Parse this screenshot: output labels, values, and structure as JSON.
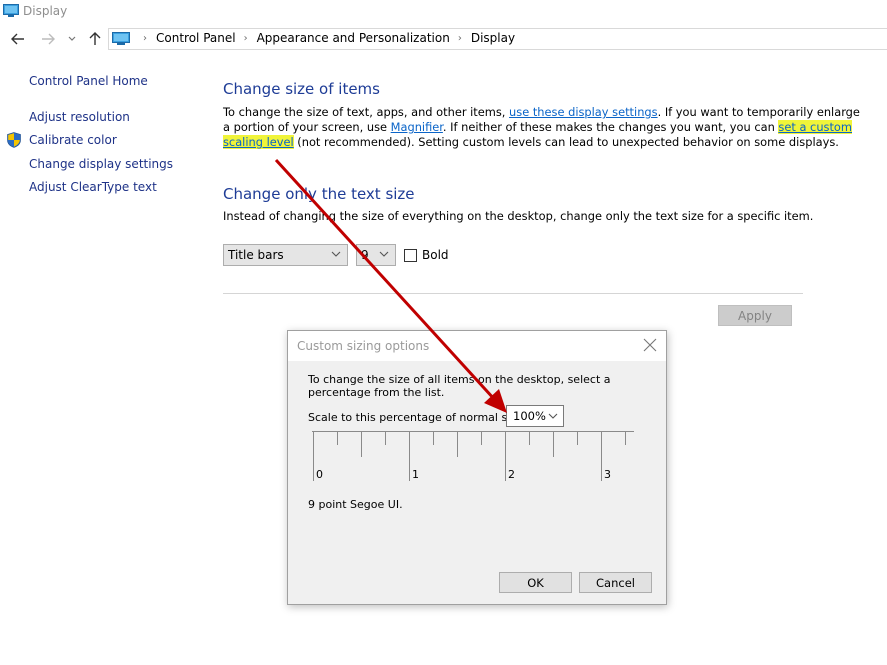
{
  "window": {
    "title": "Display",
    "icon": "monitor-icon"
  },
  "nav": {
    "back": "back-arrow-icon",
    "forward": "forward-arrow-icon",
    "recent": "chevron-down-icon",
    "up": "up-arrow-icon",
    "breadcrumbs": [
      "Control Panel",
      "Appearance and Personalization",
      "Display"
    ]
  },
  "sidebar": {
    "home": "Control Panel Home",
    "items": [
      {
        "label": "Adjust resolution",
        "icon": null
      },
      {
        "label": "Calibrate color",
        "icon": "uac-shield-icon"
      },
      {
        "label": "Change display settings",
        "icon": null
      },
      {
        "label": "Adjust ClearType text",
        "icon": null
      }
    ]
  },
  "main": {
    "section1": {
      "heading": "Change size of items",
      "line1_pre": "To change the size of text, apps, and other items, ",
      "line1_link": "use these display settings",
      "line1_post": ".  If you want to temporarily enlarge",
      "line2_pre": "a portion of your screen, use ",
      "line2_link": "Magnifier",
      "line2_post": ".  If neither of these makes the changes you want, you can ",
      "line2_link2": "set a custom",
      "line3_link": "scaling level",
      "line3_post": " (not recommended).  Setting custom levels can lead to unexpected behavior on some displays."
    },
    "section2": {
      "heading": "Change only the text size",
      "description": "Instead of changing the size of everything on the desktop, change only the text size for a specific item.",
      "item_select": "Title bars",
      "size_select": "9",
      "bold_label": "Bold",
      "bold_checked": false
    },
    "apply_label": "Apply"
  },
  "dialog": {
    "title": "Custom sizing options",
    "instruction_line1": "To change the size of all items on the desktop, select a",
    "instruction_line2": "percentage from the list.",
    "scale_label": "Scale to this percentage of normal size:",
    "scale_value": "100%",
    "ruler_labels": [
      "0",
      "1",
      "2",
      "3"
    ],
    "preview_text": "9 point Segoe UI.",
    "ok_label": "OK",
    "cancel_label": "Cancel"
  },
  "annotation": {
    "type": "red-arrow",
    "color": "#c00000"
  }
}
